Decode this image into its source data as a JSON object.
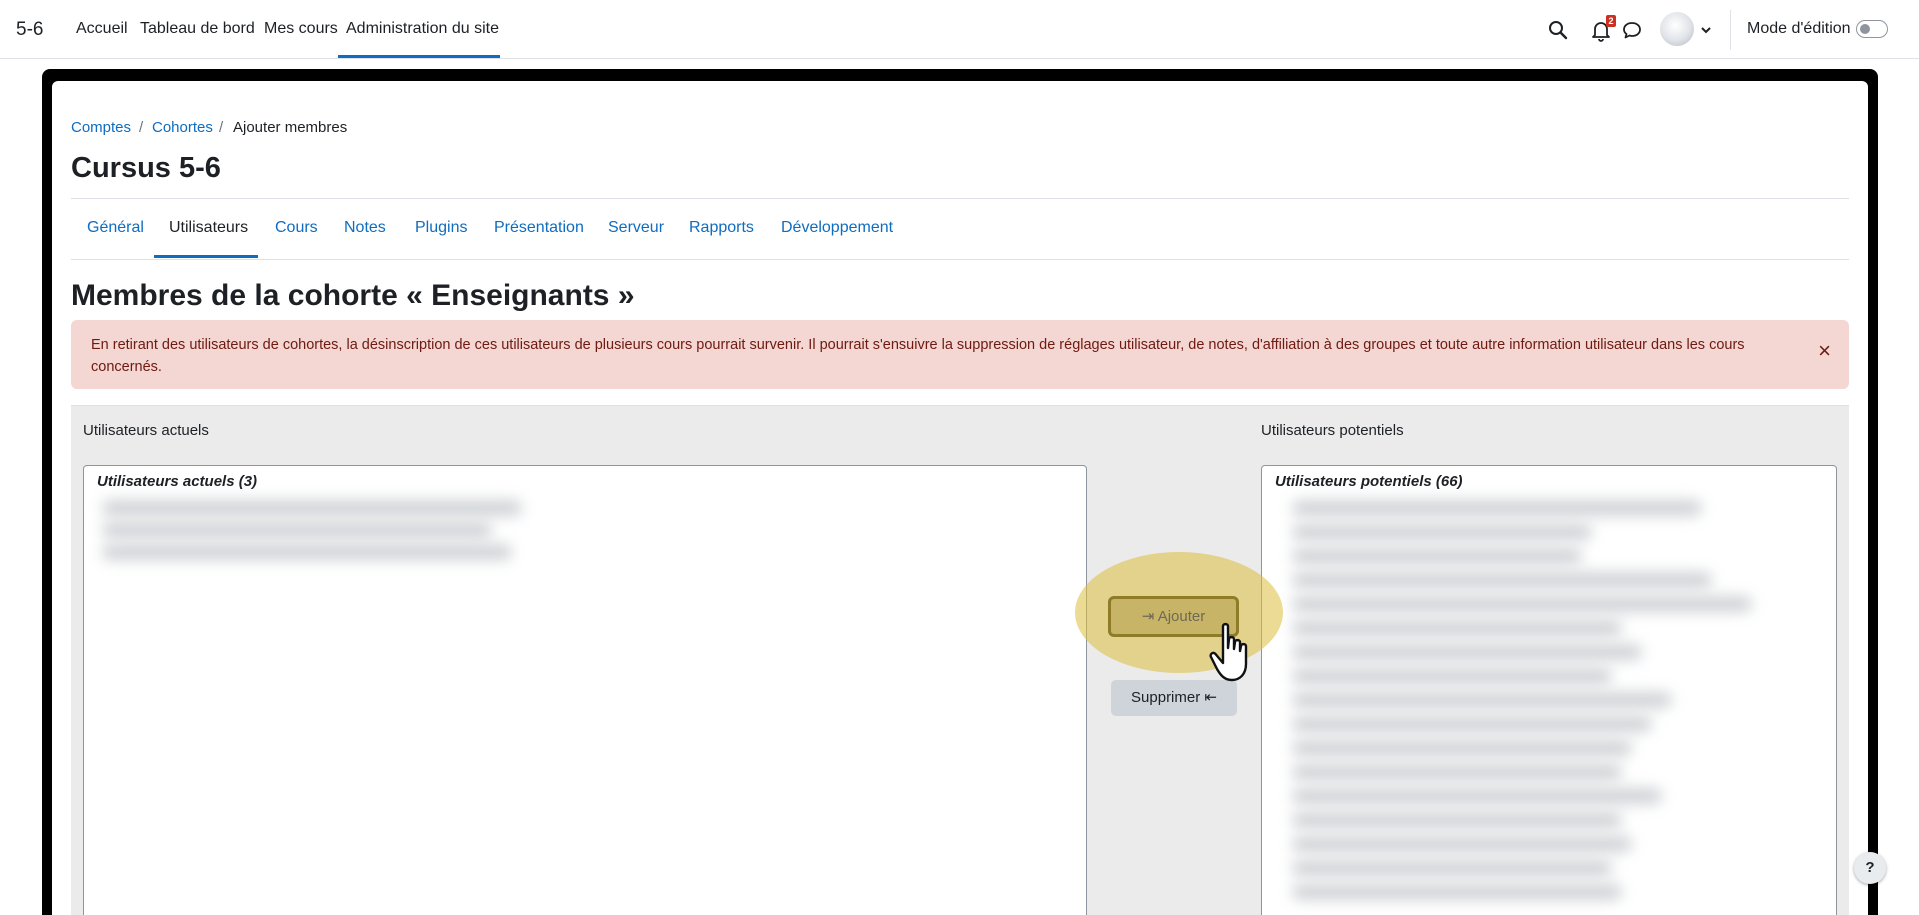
{
  "navbar": {
    "brand": "5-6",
    "items": [
      {
        "label": "Accueil"
      },
      {
        "label": "Tableau de bord"
      },
      {
        "label": "Mes cours"
      },
      {
        "label": "Administration du site"
      }
    ],
    "active_item": "Administration du site",
    "notification_count": "2",
    "edit_mode_label": "Mode d'édition",
    "edit_mode_on": false,
    "icons": {
      "search": "search-icon",
      "notifications": "bell-icon",
      "messages": "chat-bubble-icon",
      "user_menu": "chevron-down-icon"
    }
  },
  "breadcrumb": {
    "items": [
      "Comptes",
      "Cohortes",
      "Ajouter membres"
    ],
    "separator": "/"
  },
  "page_title": "Cursus 5-6",
  "admin_tabs": {
    "items": [
      "Général",
      "Utilisateurs",
      "Cours",
      "Notes",
      "Plugins",
      "Présentation",
      "Serveur",
      "Rapports",
      "Développement"
    ],
    "active": "Utilisateurs"
  },
  "heading": "Membres de la cohorte « Enseignants »",
  "alert": {
    "text": "En retirant des utilisateurs de cohortes, la désinscription de ces utilisateurs de plusieurs cours pourrait survenir. Il pourrait s'ensuivre la suppression de réglages utilisateur, de notes, d'affiliation à des groupes et toute autre information utilisateur dans les cours concernés.",
    "close_label": "×"
  },
  "current_users": {
    "label": "Utilisateurs actuels",
    "group_title": "Utilisateurs actuels (3)"
  },
  "potential_users": {
    "label": "Utilisateurs potentiels",
    "group_title": "Utilisateurs potentiels (66)"
  },
  "buttons": {
    "add": "⇥ Ajouter",
    "remove": "Supprimer ⇤"
  },
  "help_label": "?",
  "colors": {
    "link": "#0f6cbf",
    "alert_bg": "#f4d6d2",
    "alert_text": "#6e1a11",
    "highlight": "#dcbe3c"
  }
}
